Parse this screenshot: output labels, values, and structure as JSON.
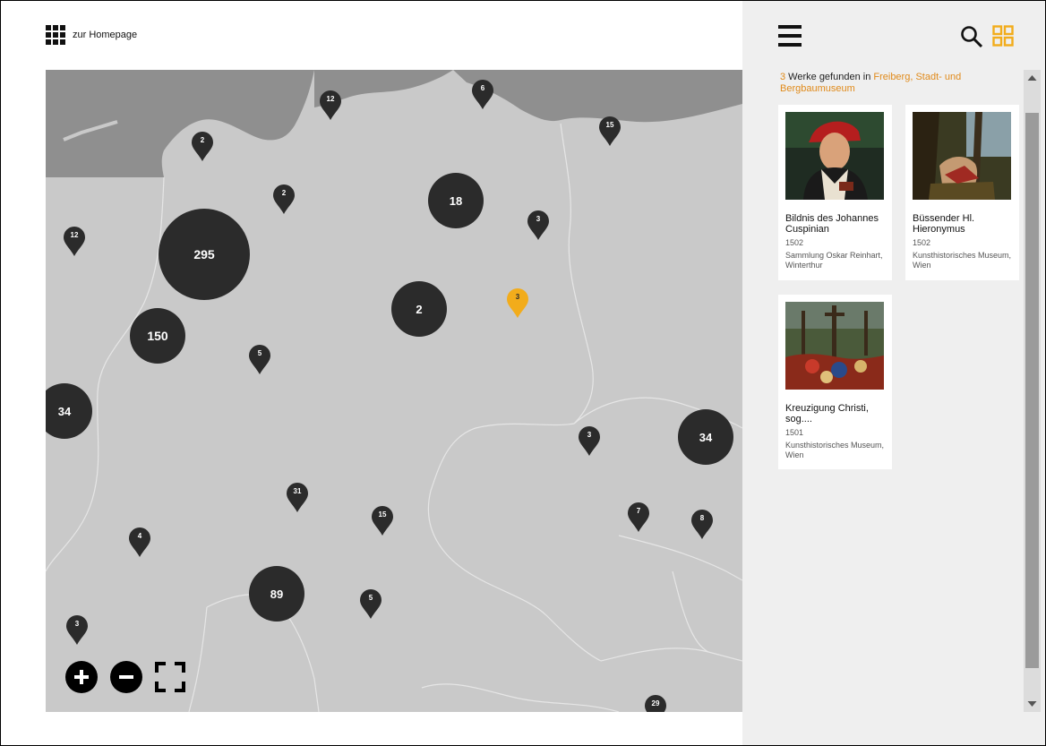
{
  "header": {
    "home_label": "zur Homepage",
    "icon": "apps-grid-icon"
  },
  "map": {
    "clusters": [
      {
        "label": "295"
      },
      {
        "label": "150"
      },
      {
        "label": "18"
      },
      {
        "label": "2"
      },
      {
        "label": "34"
      },
      {
        "label": "34"
      },
      {
        "label": "89"
      }
    ],
    "pins": [
      {
        "label": "12"
      },
      {
        "label": "6"
      },
      {
        "label": "2"
      },
      {
        "label": "15"
      },
      {
        "label": "2"
      },
      {
        "label": "3"
      },
      {
        "label": "12"
      },
      {
        "label": "3"
      },
      {
        "label": "5"
      },
      {
        "label": "3"
      },
      {
        "label": "31"
      },
      {
        "label": "15"
      },
      {
        "label": "7"
      },
      {
        "label": "8"
      },
      {
        "label": "4"
      },
      {
        "label": "5"
      },
      {
        "label": "3"
      },
      {
        "label": "29"
      }
    ],
    "pin_color": "#2b2b2b",
    "active_pin_color": "#f2ac1b",
    "controls": [
      "zoom-in-icon",
      "zoom-out-icon",
      "fullscreen-icon"
    ]
  },
  "panel": {
    "icons": [
      "menu-icon",
      "search-icon",
      "tiles-view-icon"
    ],
    "accent_color": "#f2ac1b",
    "results": {
      "count": "3",
      "text": " Werke gefunden in ",
      "location": "Freiberg, Stadt- und Bergbaumuseum"
    },
    "cards": [
      {
        "title": "Bildnis des Johannes Cuspinian",
        "year": "1502",
        "place": "Sammlung Oskar Reinhart, Winterthur"
      },
      {
        "title": "Büssender Hl. Hieronymus",
        "year": "1502",
        "place": "Kunsthistorisches Museum, Wien"
      },
      {
        "title": "Kreuzigung Christi, sog....",
        "year": "1501",
        "place": "Kunsthistorisches Museum, Wien"
      }
    ]
  }
}
